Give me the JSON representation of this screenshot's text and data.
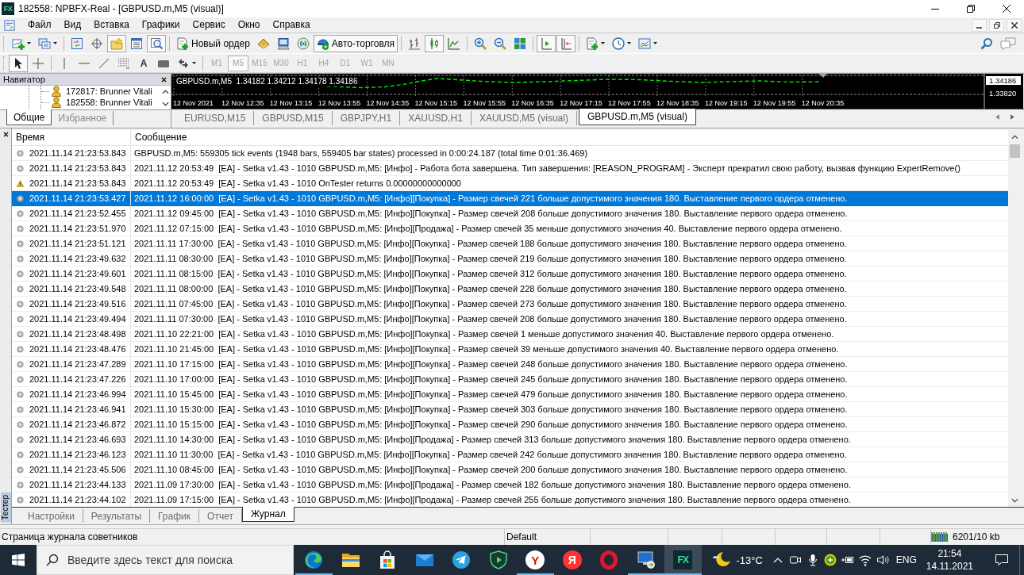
{
  "window": {
    "logo": "FX",
    "title": "182558: NPBFX-Real - [GBPUSD.m,M5 (visual)]"
  },
  "menu": [
    "Файл",
    "Вид",
    "Вставка",
    "Графики",
    "Сервис",
    "Окно",
    "Справка"
  ],
  "toolbar": {
    "groups": [
      [
        {
          "pressed": false,
          "dropdown": true
        },
        {
          "pressed": false,
          "dropdown": true
        }
      ],
      [
        {
          "pressed": false,
          "dropdown": false
        },
        {
          "pressed": false,
          "dropdown": false
        },
        {
          "pressed": true,
          "dropdown": false
        },
        {
          "pressed": false,
          "dropdown": false
        },
        {
          "pressed": true,
          "dropdown": false
        }
      ],
      [
        {
          "label": "Новый ордер",
          "pressed": false,
          "dropdown": false
        },
        {
          "pressed": false,
          "dropdown": false
        },
        {
          "pressed": false,
          "dropdown": false
        },
        {
          "pressed": false,
          "dropdown": false
        },
        {
          "label": "Авто-торговля",
          "pressed": true,
          "dropdown": false
        }
      ],
      [
        {
          "pressed": false,
          "dropdown": false
        },
        {
          "pressed": true,
          "dropdown": false
        },
        {
          "pressed": false,
          "dropdown": false
        }
      ],
      [
        {
          "pressed": false,
          "dropdown": false
        },
        {
          "pressed": false,
          "dropdown": false
        },
        {
          "pressed": false,
          "dropdown": false
        }
      ],
      [
        {
          "pressed": true,
          "dropdown": false
        },
        {
          "pressed": true,
          "dropdown": false
        }
      ],
      [
        {
          "pressed": false,
          "dropdown": true
        },
        {
          "pressed": false,
          "dropdown": true
        },
        {
          "pressed": false,
          "dropdown": true
        }
      ]
    ]
  },
  "drawing_toolbar": {
    "groups": [
      [
        {
          "pressed": true,
          "dropdown": false
        },
        {
          "pressed": false,
          "dropdown": false
        }
      ],
      [
        {
          "pressed": false,
          "dropdown": false
        },
        {
          "pressed": false,
          "dropdown": false
        },
        {
          "pressed": false,
          "dropdown": false
        },
        {
          "pressed": false,
          "dropdown": false
        },
        {
          "label": "A",
          "pressed": false,
          "dropdown": false
        },
        {
          "pressed": false,
          "dropdown": false
        },
        {
          "pressed": false,
          "dropdown": true
        }
      ]
    ]
  },
  "periods": {
    "disabled": true,
    "items": [
      {
        "label": "M1",
        "selected": false
      },
      {
        "label": "M5",
        "selected": true
      },
      {
        "label": "M15",
        "selected": false
      },
      {
        "label": "M30",
        "selected": false
      },
      {
        "label": "H1",
        "selected": false
      },
      {
        "label": "H4",
        "selected": false
      },
      {
        "label": "D1",
        "selected": false
      },
      {
        "label": "W1",
        "selected": false
      },
      {
        "label": "MN",
        "selected": false
      }
    ]
  },
  "navigator": {
    "title": "Навигатор",
    "accounts": [
      "172817: Brunner Vitali",
      "182558: Brunner Vitali"
    ],
    "tabs": [
      {
        "label": "Общие",
        "selected": true
      },
      {
        "label": "Избранное",
        "selected": false
      }
    ]
  },
  "chart": {
    "header": "GBPUSD.m,M5  1.34182 1.34212 1.34178 1.34186",
    "price_labels": [
      {
        "text": "1.34186",
        "current": true
      },
      {
        "text": "1.33820",
        "current": false
      }
    ],
    "time_labels": [
      "12 Nov 2021",
      "12 Nov 12:35",
      "12 Nov 13:15",
      "12 Nov 13:55",
      "12 Nov 14:35",
      "12 Nov 15:15",
      "12 Nov 15:55",
      "12 Nov 16:35",
      "12 Nov 17:15",
      "12 Nov 17:55",
      "12 Nov 18:35",
      "12 Nov 19:15",
      "12 Nov 19:55",
      "12 Nov 20:35"
    ]
  },
  "chart_tabs": [
    {
      "label": "EURUSD,M15",
      "selected": false
    },
    {
      "label": "GBPUSD,M15",
      "selected": false
    },
    {
      "label": "GBPJPY,H1",
      "selected": false
    },
    {
      "label": "XAUUSD,H1",
      "selected": false
    },
    {
      "label": "XAUUSD,M5 (visual)",
      "selected": false
    },
    {
      "label": "GBPUSD.m,M5 (visual)",
      "selected": true
    }
  ],
  "tester": {
    "label": "Тестер",
    "columns": [
      "Время",
      "Сообщение"
    ],
    "rows": [
      {
        "kind": "info",
        "selected": false,
        "time": "2021.11.14 21:23:53.843",
        "message": "GBPUSD.m,M5: 559305 tick events (1948 bars, 559405 bar states) processed in 0:00:24.187 (total time 0:01:36.469)"
      },
      {
        "kind": "info",
        "selected": false,
        "time": "2021.11.14 21:23:53.843",
        "message": "2021.11.12 20:53:49  [EA] - Setka v1.43 - 1010 GBPUSD.m,M5: [Инфо] - Работа бота завершена. Тип завершения: [REASON_PROGRAM] - Эксперт прекратил свою работу, вызвав функцию ExpertRemove()"
      },
      {
        "kind": "warning",
        "selected": false,
        "time": "2021.11.14 21:23:53.843",
        "message": "2021.11.12 20:53:49  [EA] - Setka v1.43 - 1010 OnTester returns 0.00000000000000"
      },
      {
        "kind": "info",
        "selected": true,
        "time": "2021.11.14 21:23:53.427",
        "message": "2021.11.12 16:00:00  [EA] - Setka v1.43 - 1010 GBPUSD.m,M5: [Инфо][Покупка] - Размер свечей 221 больше допустимого значения 180. Выставление первого ордера отменено."
      },
      {
        "kind": "info",
        "selected": false,
        "time": "2021.11.14 21:23:52.455",
        "message": "2021.11.12 09:45:00  [EA] - Setka v1.43 - 1010 GBPUSD.m,M5: [Инфо][Покупка] - Размер свечей 208 больше допустимого значения 180. Выставление первого ордера отменено."
      },
      {
        "kind": "info",
        "selected": false,
        "time": "2021.11.14 21:23:51.970",
        "message": "2021.11.12 07:15:00  [EA] - Setka v1.43 - 1010 GBPUSD.m,M5: [Инфо][Продажа] - Размер свечей 35 меньше допустимого значения 40. Выставление первого ордера отменено."
      },
      {
        "kind": "info",
        "selected": false,
        "time": "2021.11.14 21:23:51.121",
        "message": "2021.11.11 17:30:00  [EA] - Setka v1.43 - 1010 GBPUSD.m,M5: [Инфо][Покупка] - Размер свечей 188 больше допустимого значения 180. Выставление первого ордера отменено."
      },
      {
        "kind": "info",
        "selected": false,
        "time": "2021.11.14 21:23:49.632",
        "message": "2021.11.11 08:30:00  [EA] - Setka v1.43 - 1010 GBPUSD.m,M5: [Инфо][Покупка] - Размер свечей 219 больше допустимого значения 180. Выставление первого ордера отменено."
      },
      {
        "kind": "info",
        "selected": false,
        "time": "2021.11.14 21:23:49.601",
        "message": "2021.11.11 08:15:00  [EA] - Setka v1.43 - 1010 GBPUSD.m,M5: [Инфо][Покупка] - Размер свечей 312 больше допустимого значения 180. Выставление первого ордера отменено."
      },
      {
        "kind": "info",
        "selected": false,
        "time": "2021.11.14 21:23:49.548",
        "message": "2021.11.11 08:00:00  [EA] - Setka v1.43 - 1010 GBPUSD.m,M5: [Инфо][Покупка] - Размер свечей 228 больше допустимого значения 180. Выставление первого ордера отменено."
      },
      {
        "kind": "info",
        "selected": false,
        "time": "2021.11.14 21:23:49.516",
        "message": "2021.11.11 07:45:00  [EA] - Setka v1.43 - 1010 GBPUSD.m,M5: [Инфо][Покупка] - Размер свечей 273 больше допустимого значения 180. Выставление первого ордера отменено."
      },
      {
        "kind": "info",
        "selected": false,
        "time": "2021.11.14 21:23:49.494",
        "message": "2021.11.11 07:30:00  [EA] - Setka v1.43 - 1010 GBPUSD.m,M5: [Инфо][Покупка] - Размер свечей 208 больше допустимого значения 180. Выставление первого ордера отменено."
      },
      {
        "kind": "info",
        "selected": false,
        "time": "2021.11.14 21:23:48.498",
        "message": "2021.11.10 22:21:00  [EA] - Setka v1.43 - 1010 GBPUSD.m,M5: [Инфо][Покупка] - Размер свечей 1 меньше допустимого значения 40. Выставление первого ордера отменено."
      },
      {
        "kind": "info",
        "selected": false,
        "time": "2021.11.14 21:23:48.476",
        "message": "2021.11.10 21:45:00  [EA] - Setka v1.43 - 1010 GBPUSD.m,M5: [Инфо][Покупка] - Размер свечей 39 меньше допустимого значения 40. Выставление первого ордера отменено."
      },
      {
        "kind": "info",
        "selected": false,
        "time": "2021.11.14 21:23:47.289",
        "message": "2021.11.10 17:15:00  [EA] - Setka v1.43 - 1010 GBPUSD.m,M5: [Инфо][Покупка] - Размер свечей 248 больше допустимого значения 180. Выставление первого ордера отменено."
      },
      {
        "kind": "info",
        "selected": false,
        "time": "2021.11.14 21:23:47.226",
        "message": "2021.11.10 17:00:00  [EA] - Setka v1.43 - 1010 GBPUSD.m,M5: [Инфо][Покупка] - Размер свечей 245 больше допустимого значения 180. Выставление первого ордера отменено."
      },
      {
        "kind": "info",
        "selected": false,
        "time": "2021.11.14 21:23:46.994",
        "message": "2021.11.10 15:45:00  [EA] - Setka v1.43 - 1010 GBPUSD.m,M5: [Инфо][Покупка] - Размер свечей 479 больше допустимого значения 180. Выставление первого ордера отменено."
      },
      {
        "kind": "info",
        "selected": false,
        "time": "2021.11.14 21:23:46.941",
        "message": "2021.11.10 15:30:00  [EA] - Setka v1.43 - 1010 GBPUSD.m,M5: [Инфо][Покупка] - Размер свечей 303 больше допустимого значения 180. Выставление первого ордера отменено."
      },
      {
        "kind": "info",
        "selected": false,
        "time": "2021.11.14 21:23:46.872",
        "message": "2021.11.10 15:15:00  [EA] - Setka v1.43 - 1010 GBPUSD.m,M5: [Инфо][Покупка] - Размер свечей 290 больше допустимого значения 180. Выставление первого ордера отменено."
      },
      {
        "kind": "info",
        "selected": false,
        "time": "2021.11.14 21:23:46.693",
        "message": "2021.11.10 14:30:00  [EA] - Setka v1.43 - 1010 GBPUSD.m,M5: [Инфо][Продажа] - Размер свечей 313 больше допустимого значения 180. Выставление первого ордера отменено."
      },
      {
        "kind": "info",
        "selected": false,
        "time": "2021.11.14 21:23:46.123",
        "message": "2021.11.10 11:30:00  [EA] - Setka v1.43 - 1010 GBPUSD.m,M5: [Инфо][Покупка] - Размер свечей 242 больше допустимого значения 180. Выставление первого ордера отменено."
      },
      {
        "kind": "info",
        "selected": false,
        "time": "2021.11.14 21:23:45.506",
        "message": "2021.11.10 08:45:00  [EA] - Setka v1.43 - 1010 GBPUSD.m,M5: [Инфо][Покупка] - Размер свечей 200 больше допустимого значения 180. Выставление первого ордера отменено."
      },
      {
        "kind": "info",
        "selected": false,
        "time": "2021.11.14 21:23:44.133",
        "message": "2021.11.09 17:30:00  [EA] - Setka v1.43 - 1010 GBPUSD.m,M5: [Инфо][Продажа] - Размер свечей 182 больше допустимого значения 180. Выставление первого ордера отменено."
      },
      {
        "kind": "info",
        "selected": false,
        "time": "2021.11.14 21:23:44.102",
        "message": "2021.11.09 17:15:00  [EA] - Setka v1.43 - 1010 GBPUSD.m,M5: [Инфо][Продажа] - Размер свечей 255 больше допустимого значения 180. Выставление первого ордера отменено."
      }
    ],
    "tabs": [
      {
        "label": "Настройки",
        "selected": false
      },
      {
        "label": "Результаты",
        "selected": false
      },
      {
        "label": "График",
        "selected": false
      },
      {
        "label": "Отчет",
        "selected": false
      },
      {
        "label": "Журнал",
        "selected": true
      }
    ]
  },
  "status_bar": {
    "message": "Страница журнала советников",
    "profile": "Default",
    "traffic": "6201/10 kb"
  },
  "taskbar": {
    "search": {
      "placeholder": "Введите здесь текст для поиска"
    },
    "apps": [
      {
        "running": true,
        "active": false
      },
      {
        "running": false,
        "active": false
      },
      {
        "running": false,
        "active": false
      },
      {
        "running": false,
        "active": false
      },
      {
        "running": false,
        "active": false
      },
      {
        "running": false,
        "active": false
      },
      {
        "glyph": "Y",
        "running": true,
        "active": false
      },
      {
        "glyph": "Я",
        "running": false,
        "active": false
      },
      {
        "running": false,
        "active": false
      },
      {
        "running": true,
        "active": false
      },
      {
        "glyph": "FX",
        "running": true,
        "active": true
      }
    ],
    "weather": "-13°C",
    "language": "ENG",
    "time": "21:54",
    "date": "14.11.2021"
  }
}
